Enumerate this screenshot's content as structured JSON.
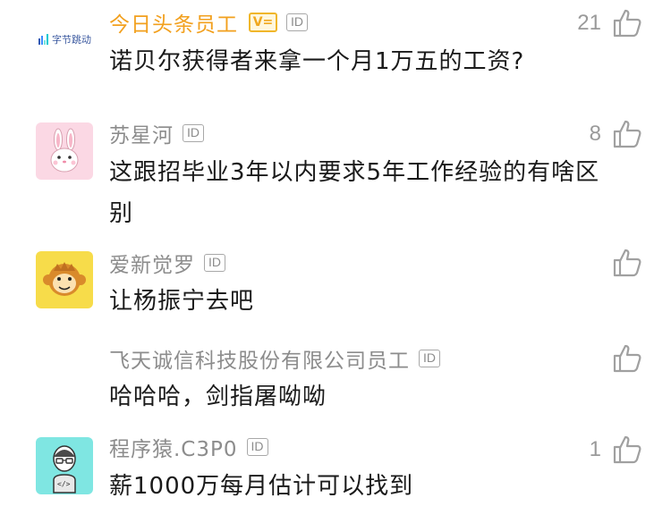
{
  "comments": [
    {
      "name": "今日头条员工",
      "verified_badge": "V=",
      "id_badge": "ID",
      "avatar_text": "字节跳动",
      "text": "诺贝尔获得者来拿一个月1万五的工资?",
      "likes": "21"
    },
    {
      "name": "苏星河",
      "id_badge": "ID",
      "avatar": "rabbit-avatar",
      "text": "这跟招毕业3年以内要求5年工作经验的有啥区别",
      "likes": "8"
    },
    {
      "name": "爱新觉罗",
      "id_badge": "ID",
      "avatar": "monkey-avatar",
      "text": "让杨振宁去吧",
      "likes": ""
    },
    {
      "name": "飞天诚信科技股份有限公司员工",
      "id_badge": "ID",
      "text": "哈哈哈，剑指屠呦呦",
      "likes": ""
    },
    {
      "name": "程序猿.C3P0",
      "id_badge": "ID",
      "avatar": "programmer-avatar",
      "avatar_text": "</>",
      "text": "薪1000万每月估计可以找到",
      "likes": "1"
    }
  ]
}
